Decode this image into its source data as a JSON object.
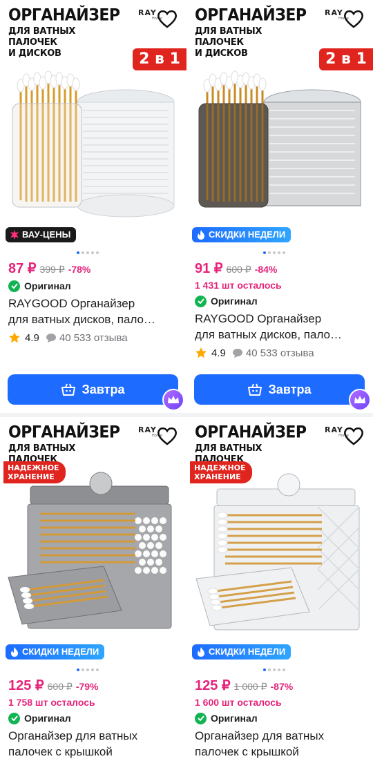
{
  "cards": [
    {
      "promo_title": "ОРГАНАЙЗЕР",
      "promo_subtitle_1": "ДЛЯ ВАТНЫХ ПАЛОЧЕК",
      "promo_subtitle_2": "И ДИСКОВ",
      "brand": "RAYGOOD",
      "brand_sub": "Home",
      "corner_badge": "2 в 1",
      "chip": "ВАУ-ЦЕНЫ",
      "price": "87 ₽",
      "old_price": "399 ₽",
      "discount": "-78%",
      "stock_left": "",
      "original": "Оригинал",
      "title_line1": "RAYGOOD Органайзер",
      "title_line2": "для ватных дисков, пало…",
      "rating": "4.9",
      "reviews": "40 533 отзыва",
      "cta": "Завтра"
    },
    {
      "promo_title": "ОРГАНАЙЗЕР",
      "promo_subtitle_1": "ДЛЯ ВАТНЫХ ПАЛОЧЕК",
      "promo_subtitle_2": "И ДИСКОВ",
      "brand": "RAYGOOD",
      "brand_sub": "Home",
      "corner_badge": "2 в 1",
      "chip": "СКИДКИ НЕДЕЛИ",
      "price": "91 ₽",
      "old_price": "600 ₽",
      "discount": "-84%",
      "stock_left": "1 431 шт осталось",
      "original": "Оригинал",
      "title_line1": "RAYGOOD Органайзер",
      "title_line2": "для ватных дисков, пало…",
      "rating": "4.9",
      "reviews": "40 533 отзыва",
      "cta": "Завтра"
    },
    {
      "promo_title": "ОРГАНАЙЗЕР",
      "promo_subtitle_1": "ДЛЯ ВАТНЫХ ПАЛОЧЕК",
      "brand": "RAYGOOD",
      "brand_sub": "Home",
      "safe_tag": "НАДЕЖНОЕ ХРАНЕНИЕ",
      "chip": "СКИДКИ НЕДЕЛИ",
      "price": "125 ₽",
      "old_price": "600 ₽",
      "discount": "-79%",
      "stock_left": "1 758 шт осталось",
      "original": "Оригинал",
      "title_line1": "Органайзер для ватных",
      "title_line2": "палочек с крышкой"
    },
    {
      "promo_title": "ОРГАНАЙЗЕР",
      "promo_subtitle_1": "ДЛЯ ВАТНЫХ ПАЛОЧЕК",
      "brand": "RAYGOOD",
      "brand_sub": "Home",
      "safe_tag": "НАДЕЖНОЕ ХРАНЕНИЕ",
      "chip": "СКИДКИ НЕДЕЛИ",
      "price": "125 ₽",
      "old_price": "1 000 ₽",
      "discount": "-87%",
      "stock_left": "1 600 шт осталось",
      "original": "Оригинал",
      "title_line1": "Органайзер для ватных",
      "title_line2": "палочек с крышкой"
    }
  ],
  "colors": {
    "accent": "#1e6bff",
    "price": "#e6237a",
    "badge_red": "#e0251f",
    "original_check": "#12b452"
  }
}
